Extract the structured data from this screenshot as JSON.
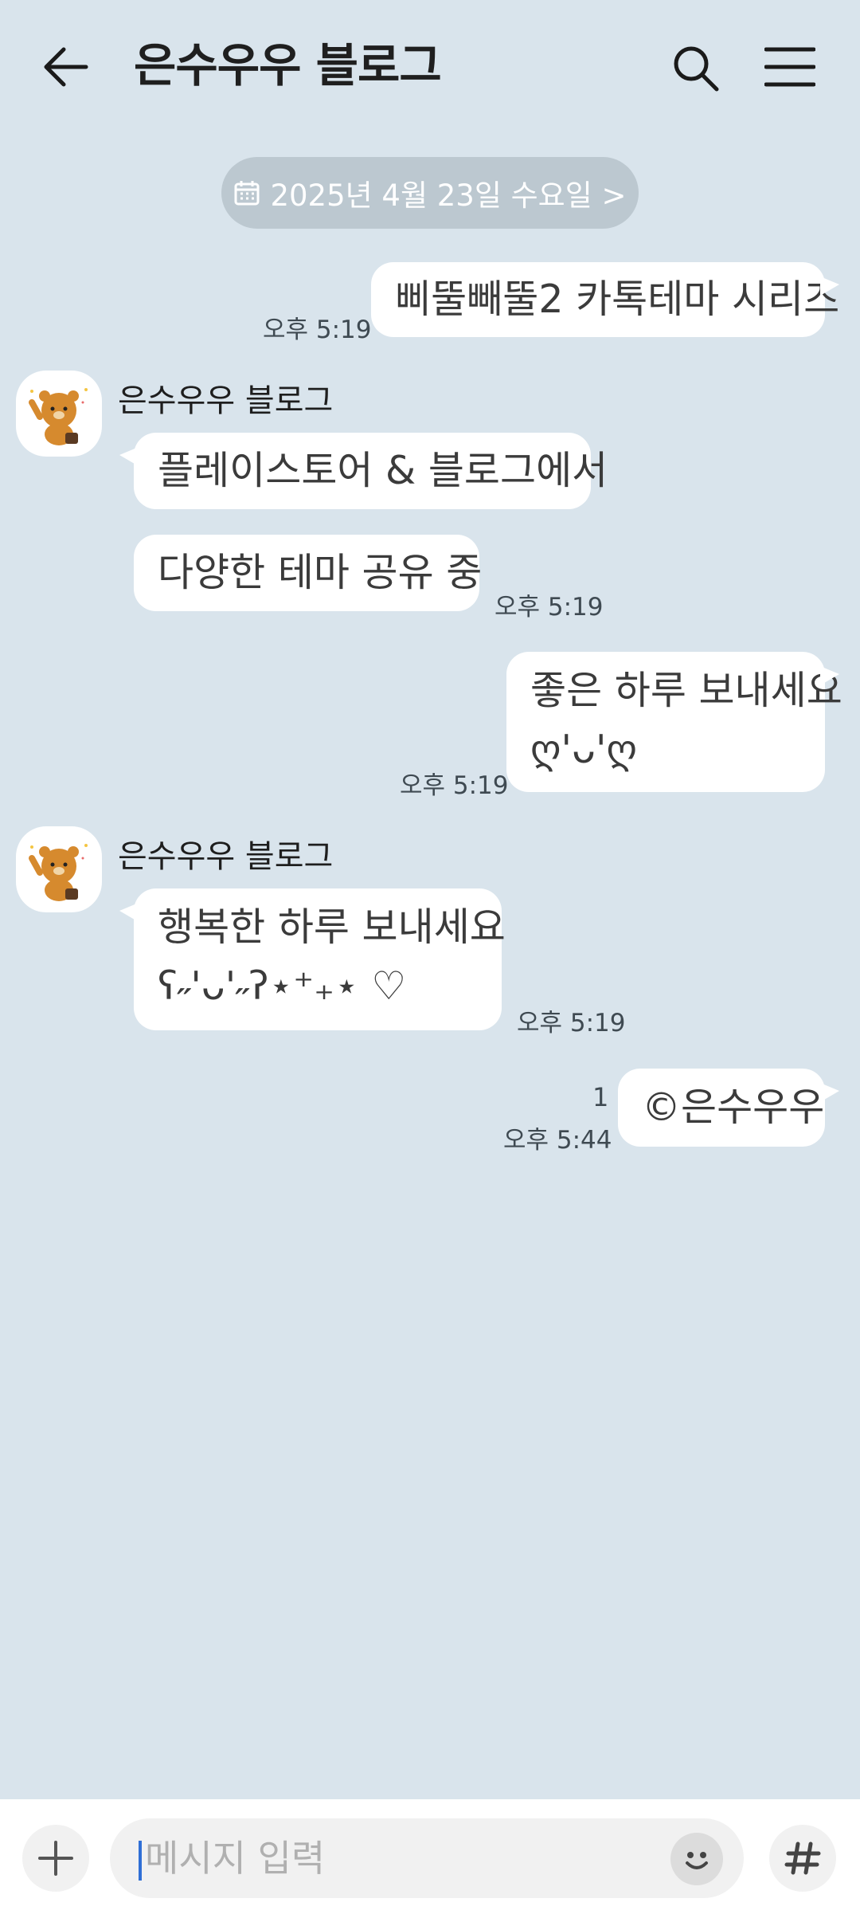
{
  "header": {
    "title": "은수우우 블로그",
    "back_icon": "back-arrow-icon",
    "search_icon": "search-icon",
    "menu_icon": "hamburger-menu-icon"
  },
  "date_divider": {
    "label": "2025년 4월 23일 수요일 >",
    "icon": "calendar-icon"
  },
  "messages": [
    {
      "side": "right",
      "lines": [
        "삐뚤빼뚤2 카톡테마 시리즈"
      ],
      "time": "오후 5:19"
    },
    {
      "side": "left",
      "sender": "은수우우 블로그",
      "lines": [
        "플레이스토어 & 블로그에서"
      ]
    },
    {
      "side": "left",
      "lines": [
        "다양한 테마 공유 중"
      ],
      "time": "오후 5:19"
    },
    {
      "side": "right",
      "lines": [
        "좋은 하루 보내세요",
        "ღ'ᴗ'ღ"
      ],
      "time": "오후 5:19"
    },
    {
      "side": "left",
      "sender": "은수우우 블로그",
      "lines": [
        "행복한 하루 보내세요",
        "ʕ˶'ᴗ'˶ʔ⋆⁺₊⋆ ♡"
      ],
      "time": "오후 5:19"
    },
    {
      "side": "right",
      "lines": [
        "©은수우우"
      ],
      "time": "오후 5:44",
      "unread": "1"
    }
  ],
  "input": {
    "placeholder": "메시지 입력",
    "plus_icon": "plus-icon",
    "emoji_icon": "emoji-icon",
    "hash_icon": "hashtag-icon"
  },
  "colors": {
    "background": "#d9e4ec",
    "bubble": "#ffffff",
    "date_pill": "#bcc8d0",
    "cursor": "#2f6fd6"
  }
}
